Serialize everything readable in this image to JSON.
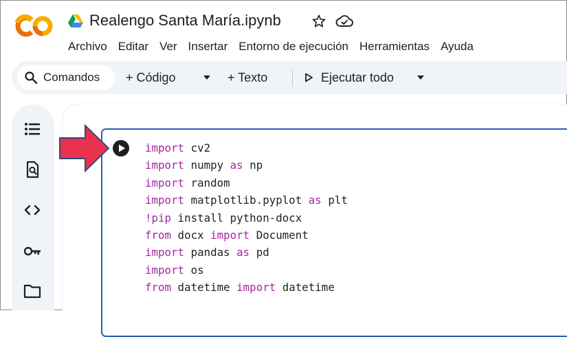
{
  "app": {
    "logo_text": "CO",
    "title": "Realengo Santa María.ipynb"
  },
  "menu": [
    "Archivo",
    "Editar",
    "Ver",
    "Insertar",
    "Entorno de ejecución",
    "Herramientas",
    "Ayuda"
  ],
  "toolbar": {
    "commands_label": "Comandos",
    "code_label": "+ Código",
    "text_label": "+ Texto",
    "run_all_label": "Ejecutar todo"
  },
  "sidebar": {
    "icons": [
      "table-of-contents-icon",
      "find-replace-icon",
      "code-snippets-icon",
      "secrets-key-icon",
      "files-folder-icon"
    ]
  },
  "cell": {
    "lines": [
      {
        "kw": "import",
        "rest": " cv2"
      },
      {
        "kw": "import",
        "rest": " numpy ",
        "kw2": "as",
        "rest2": " np"
      },
      {
        "kw": "import",
        "rest": " random"
      },
      {
        "kw": "import",
        "rest": " matplotlib.pyplot ",
        "kw2": "as",
        "rest2": " plt"
      },
      {
        "kw": "!pip",
        "rest": " install python-docx"
      },
      {
        "kw": "from",
        "rest": " docx ",
        "kw2": "import",
        "rest2": " Document"
      },
      {
        "kw": "import",
        "rest": " pandas ",
        "kw2": "as",
        "rest2": " pd"
      },
      {
        "kw": "import",
        "rest": " os"
      },
      {
        "kw": "from",
        "rest": " datetime ",
        "kw2": "import",
        "rest2": " datetime"
      }
    ]
  },
  "colors": {
    "logo_orange": "#f9ab00",
    "logo_dark_orange": "#e8710a",
    "cell_border": "#2f5eb8",
    "keyword": "#a626a4",
    "arrow_fill": "#e8324e",
    "arrow_stroke": "#2f4b7c",
    "toolbar_bg": "#f0f4f9"
  }
}
